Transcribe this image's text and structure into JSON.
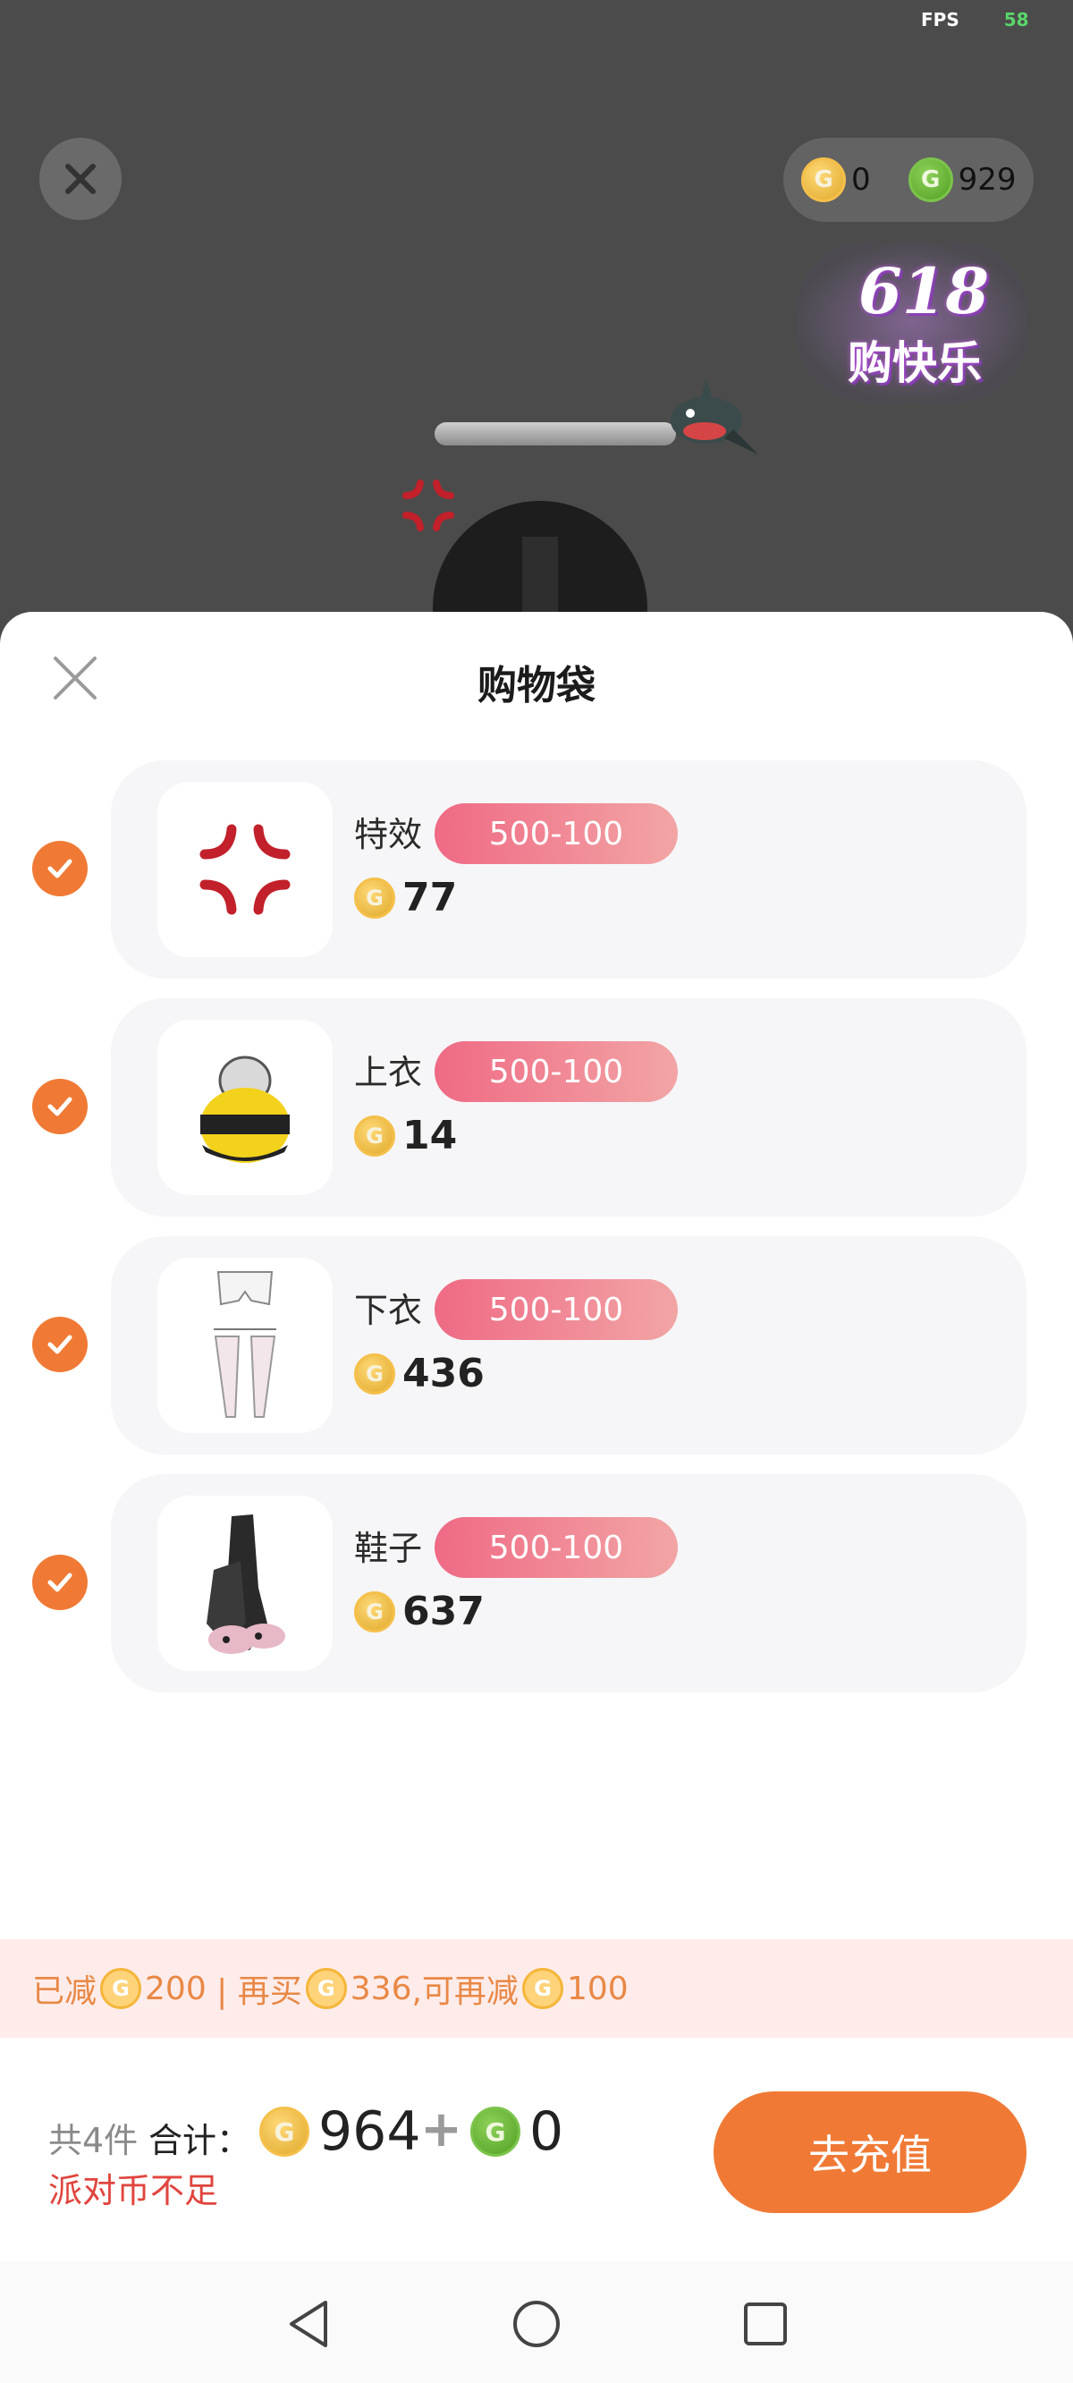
{
  "status": {
    "fps_label": "FPS",
    "fps_value": "58"
  },
  "scene": {
    "balance_gold": "0",
    "balance_green": "929",
    "event_badge_line1": "618",
    "event_badge_line2": "购快乐"
  },
  "sheet": {
    "title": "购物袋",
    "items": [
      {
        "name": "特效",
        "promo": "500-100",
        "price": "77",
        "checked": true,
        "icon": "anger-effect-icon"
      },
      {
        "name": "上衣",
        "promo": "500-100",
        "price": "14",
        "checked": true,
        "icon": "bee-top-icon"
      },
      {
        "name": "下衣",
        "promo": "500-100",
        "price": "436",
        "checked": true,
        "icon": "pants-stockings-icon"
      },
      {
        "name": "鞋子",
        "promo": "500-100",
        "price": "637",
        "checked": true,
        "icon": "boots-icon"
      }
    ]
  },
  "discount": {
    "part1": "已减",
    "amount_reduced": "200",
    "part2": " | 再买",
    "amount_more": "336",
    "part3": ",可再减",
    "amount_next": "100"
  },
  "footer": {
    "count": "共4件",
    "total_label": "合计：",
    "total_gold": "964",
    "plus": "+",
    "total_green": "0",
    "warning": "派对币不足",
    "recharge_label": "去充值"
  },
  "colors": {
    "accent": "#f07a35",
    "promo_start": "#ef6a85",
    "promo_end": "#f2a5a5",
    "warning": "#e0453e",
    "discount_bg": "#fdecea"
  }
}
